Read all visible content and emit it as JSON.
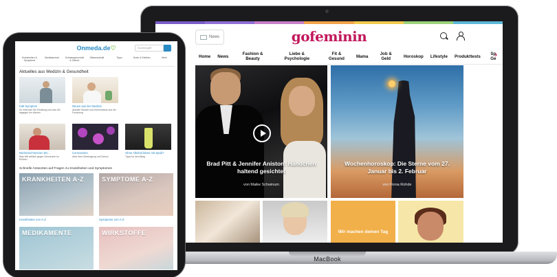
{
  "macbook": {
    "label": "MacBook",
    "site": {
      "topbar_colors": [
        "#7a5cc7",
        "#8f6ed6",
        "#c77dc9",
        "#f2a24a",
        "#f2c94c",
        "#9bd17a",
        "#5cb7d6"
      ],
      "accent": "#c2185b",
      "news_label": "News",
      "logo": "gofeminin",
      "nav": [
        "Home",
        "News",
        "Fashion & Beauty",
        "Liebe & Psychologie",
        "Fit & Gesund",
        "Mama",
        "Job & Geld",
        "Horoskop",
        "Lifestyle",
        "Produkttests",
        "Sp Ge"
      ],
      "nav_arrow": "›",
      "cards": [
        {
          "title": "Brad Pitt & Jennifer Aniston: Händchen haltend gesichtet",
          "author": "von Maike Schwinum"
        },
        {
          "title": "Wochenhoroskop: Die Sterne vom 27. Januar bis 2. Februar",
          "author": "von Fiona Rohde"
        }
      ],
      "promo": "Wir machen deinen Tag"
    }
  },
  "ipad": {
    "site": {
      "logo": "Onmeda.de",
      "logo_leaf": "♡",
      "search_placeholder": "Suchbegriff",
      "accent": "#2a8bc4",
      "nav": [
        "Krankheiten & Symptome",
        "Medikamente",
        "Schwangerschaft & Geburt",
        "Wissenschaft",
        "Tipps",
        "Ärzte & Kliniken",
        "Mehr"
      ],
      "section1": "Aktuelles aus Medizin & Gesundheit",
      "row1": [
        {
          "title": "Kalt Symptom",
          "sub": "So erkennen Sie Erkältung und was Sie dagegen tun können"
        },
        {
          "title": "Neues aus der Medizin",
          "sub": "Aktuelle Studien und Erkenntnisse aus der Forschung"
        }
      ],
      "row2": [
        {
          "title": "Rückenschmerzen bei...",
          "sub": "Was hilft wirklich gegen Schmerzen im Rücken"
        },
        {
          "title": "Coronaviren",
          "sub": "Alles über Übertragung und Schutz"
        },
        {
          "title": "Ohne Alkohol leben mit Spaß?",
          "sub": "Tipps für den Alltag"
        }
      ],
      "section2": "Schnelle Antworten auf Fragen zu Krankheiten und Symptomen",
      "big": [
        {
          "label": "KRANKHEITEN A-Z",
          "caption": "Krankheiten von A-Z"
        },
        {
          "label": "SYMPTOME A-Z",
          "caption": "Symptome von A-Z"
        },
        {
          "label": "MEDIKAMENTE",
          "caption": ""
        },
        {
          "label": "WIRKSTOFFE",
          "caption": ""
        }
      ]
    }
  }
}
